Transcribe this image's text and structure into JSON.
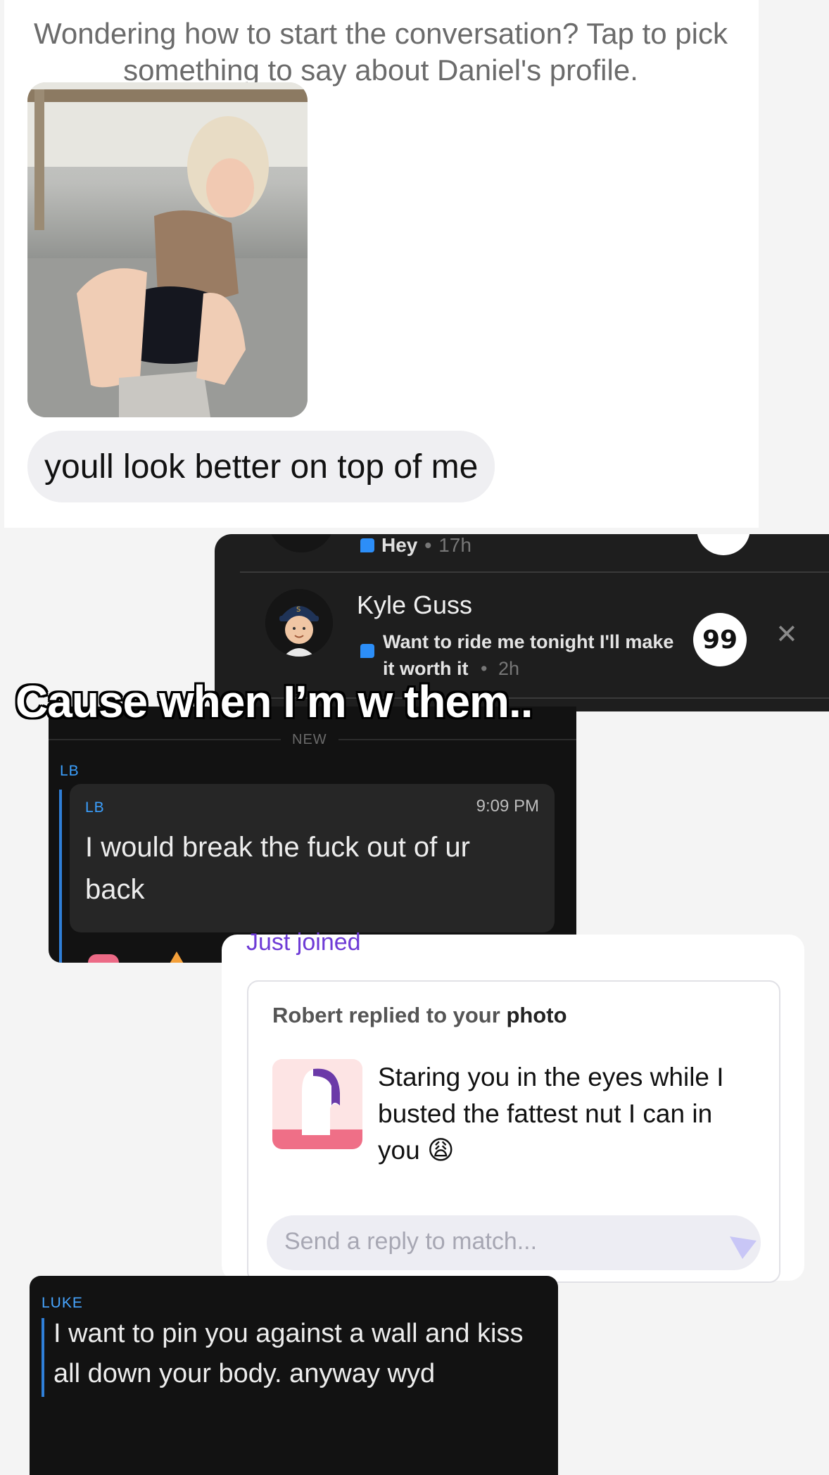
{
  "panel1": {
    "prompt_text": "Wondering how to start the conversation? Tap to pick something to say about Daniel's profile.",
    "message": "youll look better on top of me"
  },
  "panel2": {
    "top_row": {
      "preview": "Hey",
      "separator": "•",
      "time": "17h"
    },
    "row": {
      "name": "Kyle Guss",
      "preview": "Want to ride me tonight I'll make it worth it",
      "separator": "•",
      "time": "2h"
    },
    "reply_glyph": "99",
    "dismiss_glyph": "✕",
    "colors": {
      "bg": "#1e1e1e",
      "chat_icon": "#2c8ef8"
    }
  },
  "caption": "Cause when I’m w them..",
  "panel3": {
    "divider_label": "NEW",
    "sender_top": "LB",
    "sender_card": "LB",
    "time": "9:09 PM",
    "message": "I would break the fuck out of ur back",
    "colors": {
      "sender": "#3ba0ff",
      "bar": "#2f7fd8"
    }
  },
  "panel4": {
    "header": "Just joined",
    "notification_prefix": "Robert replied to your",
    "notification_emph": "photo",
    "message": "Staring you in the eyes while I busted the fattest nut I can in you",
    "emoji": "😩",
    "reply_placeholder": "Send a reply to match...",
    "colors": {
      "header": "#6e3bd6",
      "avatar_bg": "#fde4e4",
      "avatar_accent": "#ef6f87"
    }
  },
  "panel5": {
    "sender": "LUKE",
    "message": "I want to pin you against a wall and kiss all down  your body. anyway wyd",
    "colors": {
      "sender": "#47a5ff",
      "bar": "#2f7fd8"
    }
  }
}
